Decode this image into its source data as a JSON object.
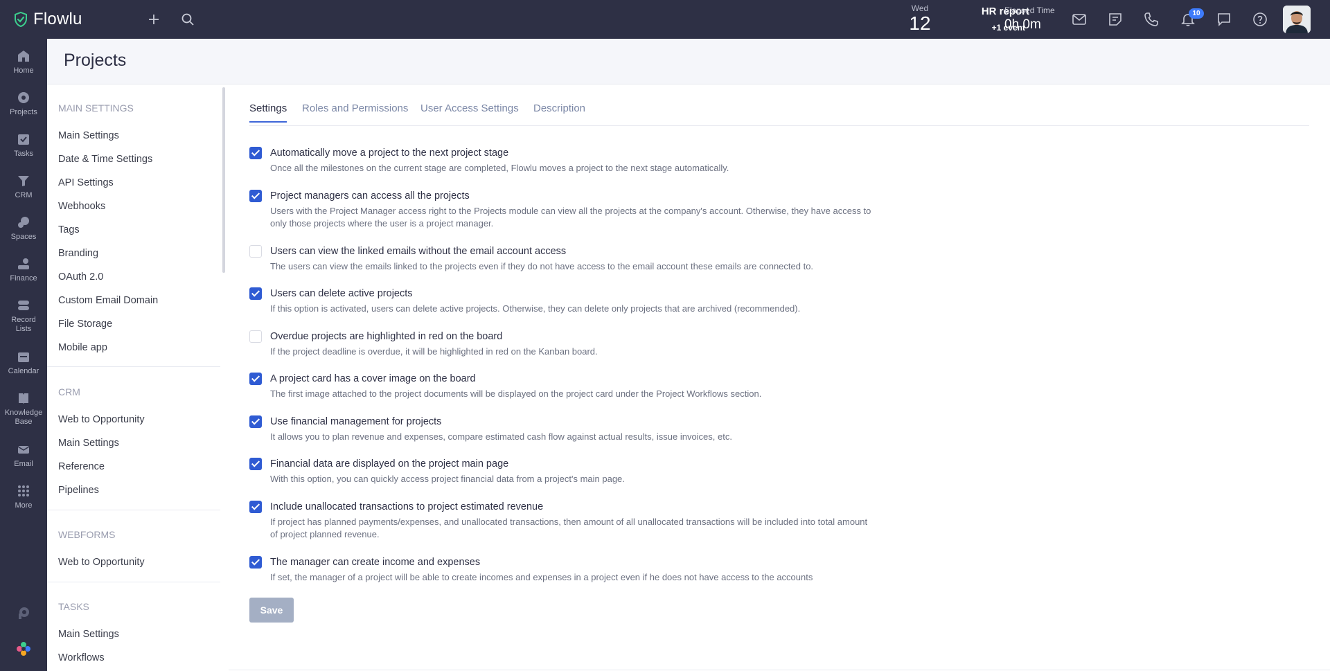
{
  "app": {
    "name": "Flowlu"
  },
  "topbar": {
    "date": {
      "dow": "Wed",
      "day": "12"
    },
    "event": {
      "title": "HR report",
      "more": "+1 event"
    },
    "elapsed": {
      "label": "Elapsed Time",
      "value": "0h 0m"
    },
    "notifications": "10"
  },
  "rail": [
    {
      "label": "Home",
      "icon": "home-icon"
    },
    {
      "label": "Projects",
      "icon": "projects-icon"
    },
    {
      "label": "Tasks",
      "icon": "tasks-icon"
    },
    {
      "label": "CRM",
      "icon": "crm-icon"
    },
    {
      "label": "Spaces",
      "icon": "spaces-icon"
    },
    {
      "label": "Finance",
      "icon": "finance-icon"
    },
    {
      "label": "Record Lists",
      "icon": "record-lists-icon"
    },
    {
      "label": "Calendar",
      "icon": "calendar-icon"
    },
    {
      "label": "Knowledge Base",
      "icon": "knowledge-base-icon"
    },
    {
      "label": "Email",
      "icon": "email-icon"
    },
    {
      "label": "More",
      "icon": "more-icon"
    }
  ],
  "page": {
    "title": "Projects"
  },
  "nav": {
    "main_settings": {
      "heading": "Main settings",
      "items": [
        "Main Settings",
        "Date & Time Settings",
        "API Settings",
        "Webhooks",
        "Tags",
        "Branding",
        "OAuth 2.0",
        "Custom Email Domain",
        "File Storage",
        "Mobile app"
      ]
    },
    "crm": {
      "heading": "CRM",
      "items": [
        "Web to Opportunity",
        "Main Settings",
        "Reference",
        "Pipelines"
      ]
    },
    "webforms": {
      "heading": "Webforms",
      "items": [
        "Web to Opportunity"
      ]
    },
    "tasks": {
      "heading": "Tasks",
      "items": [
        "Main Settings",
        "Workflows"
      ]
    }
  },
  "tabs": [
    "Settings",
    "Roles and Permissions",
    "User Access Settings",
    "Description"
  ],
  "options": [
    {
      "checked": true,
      "title": "Automatically move a project to the next project stage",
      "desc": "Once all the milestones on the current stage are completed, Flowlu moves a project to the next stage automatically."
    },
    {
      "checked": true,
      "title": "Project managers can access all the projects",
      "desc": "Users with the Project Manager access right to the Projects module can view all the projects at the company's account. Otherwise, they have access to only those projects where the user is a project manager."
    },
    {
      "checked": false,
      "title": "Users can view the linked emails without the email account access",
      "desc": "The users can view the emails linked to the projects even if they do not have access to the email account these emails are connected to."
    },
    {
      "checked": true,
      "title": "Users can delete active projects",
      "desc": "If this option is activated, users can delete active projects. Otherwise, they can delete only projects that are archived (recommended)."
    },
    {
      "checked": false,
      "title": "Overdue projects are highlighted in red on the board",
      "desc": "If the project deadline is overdue, it will be highlighted in red on the Kanban board."
    },
    {
      "checked": true,
      "title": "A project card has a cover image on the board",
      "desc": "The first image attached to the project documents will be displayed on the project card under the Project Workflows section."
    },
    {
      "checked": true,
      "title": "Use financial management for projects",
      "desc": "It allows you to plan revenue and expenses, compare estimated cash flow against actual results, issue invoices, etc."
    },
    {
      "checked": true,
      "title": "Financial data are displayed on the project main page",
      "desc": "With this option, you can quickly access project financial data from a project's main page."
    },
    {
      "checked": true,
      "title": "Include unallocated transactions to project estimated revenue",
      "desc": "If project has planned payments/expenses, and unallocated transactions, then amount of all unallocated transactions will be included into total amount of project planned revenue."
    },
    {
      "checked": true,
      "title": "The manager can create income and expenses",
      "desc": "If set, the manager of a project will be able to create incomes and expenses in a project even if he does not have access to the accounts"
    }
  ],
  "save_label": "Save",
  "colors": {
    "topbar": "#2e3045",
    "accent": "#2f5bd3",
    "save_disabled": "#a4afc4"
  }
}
